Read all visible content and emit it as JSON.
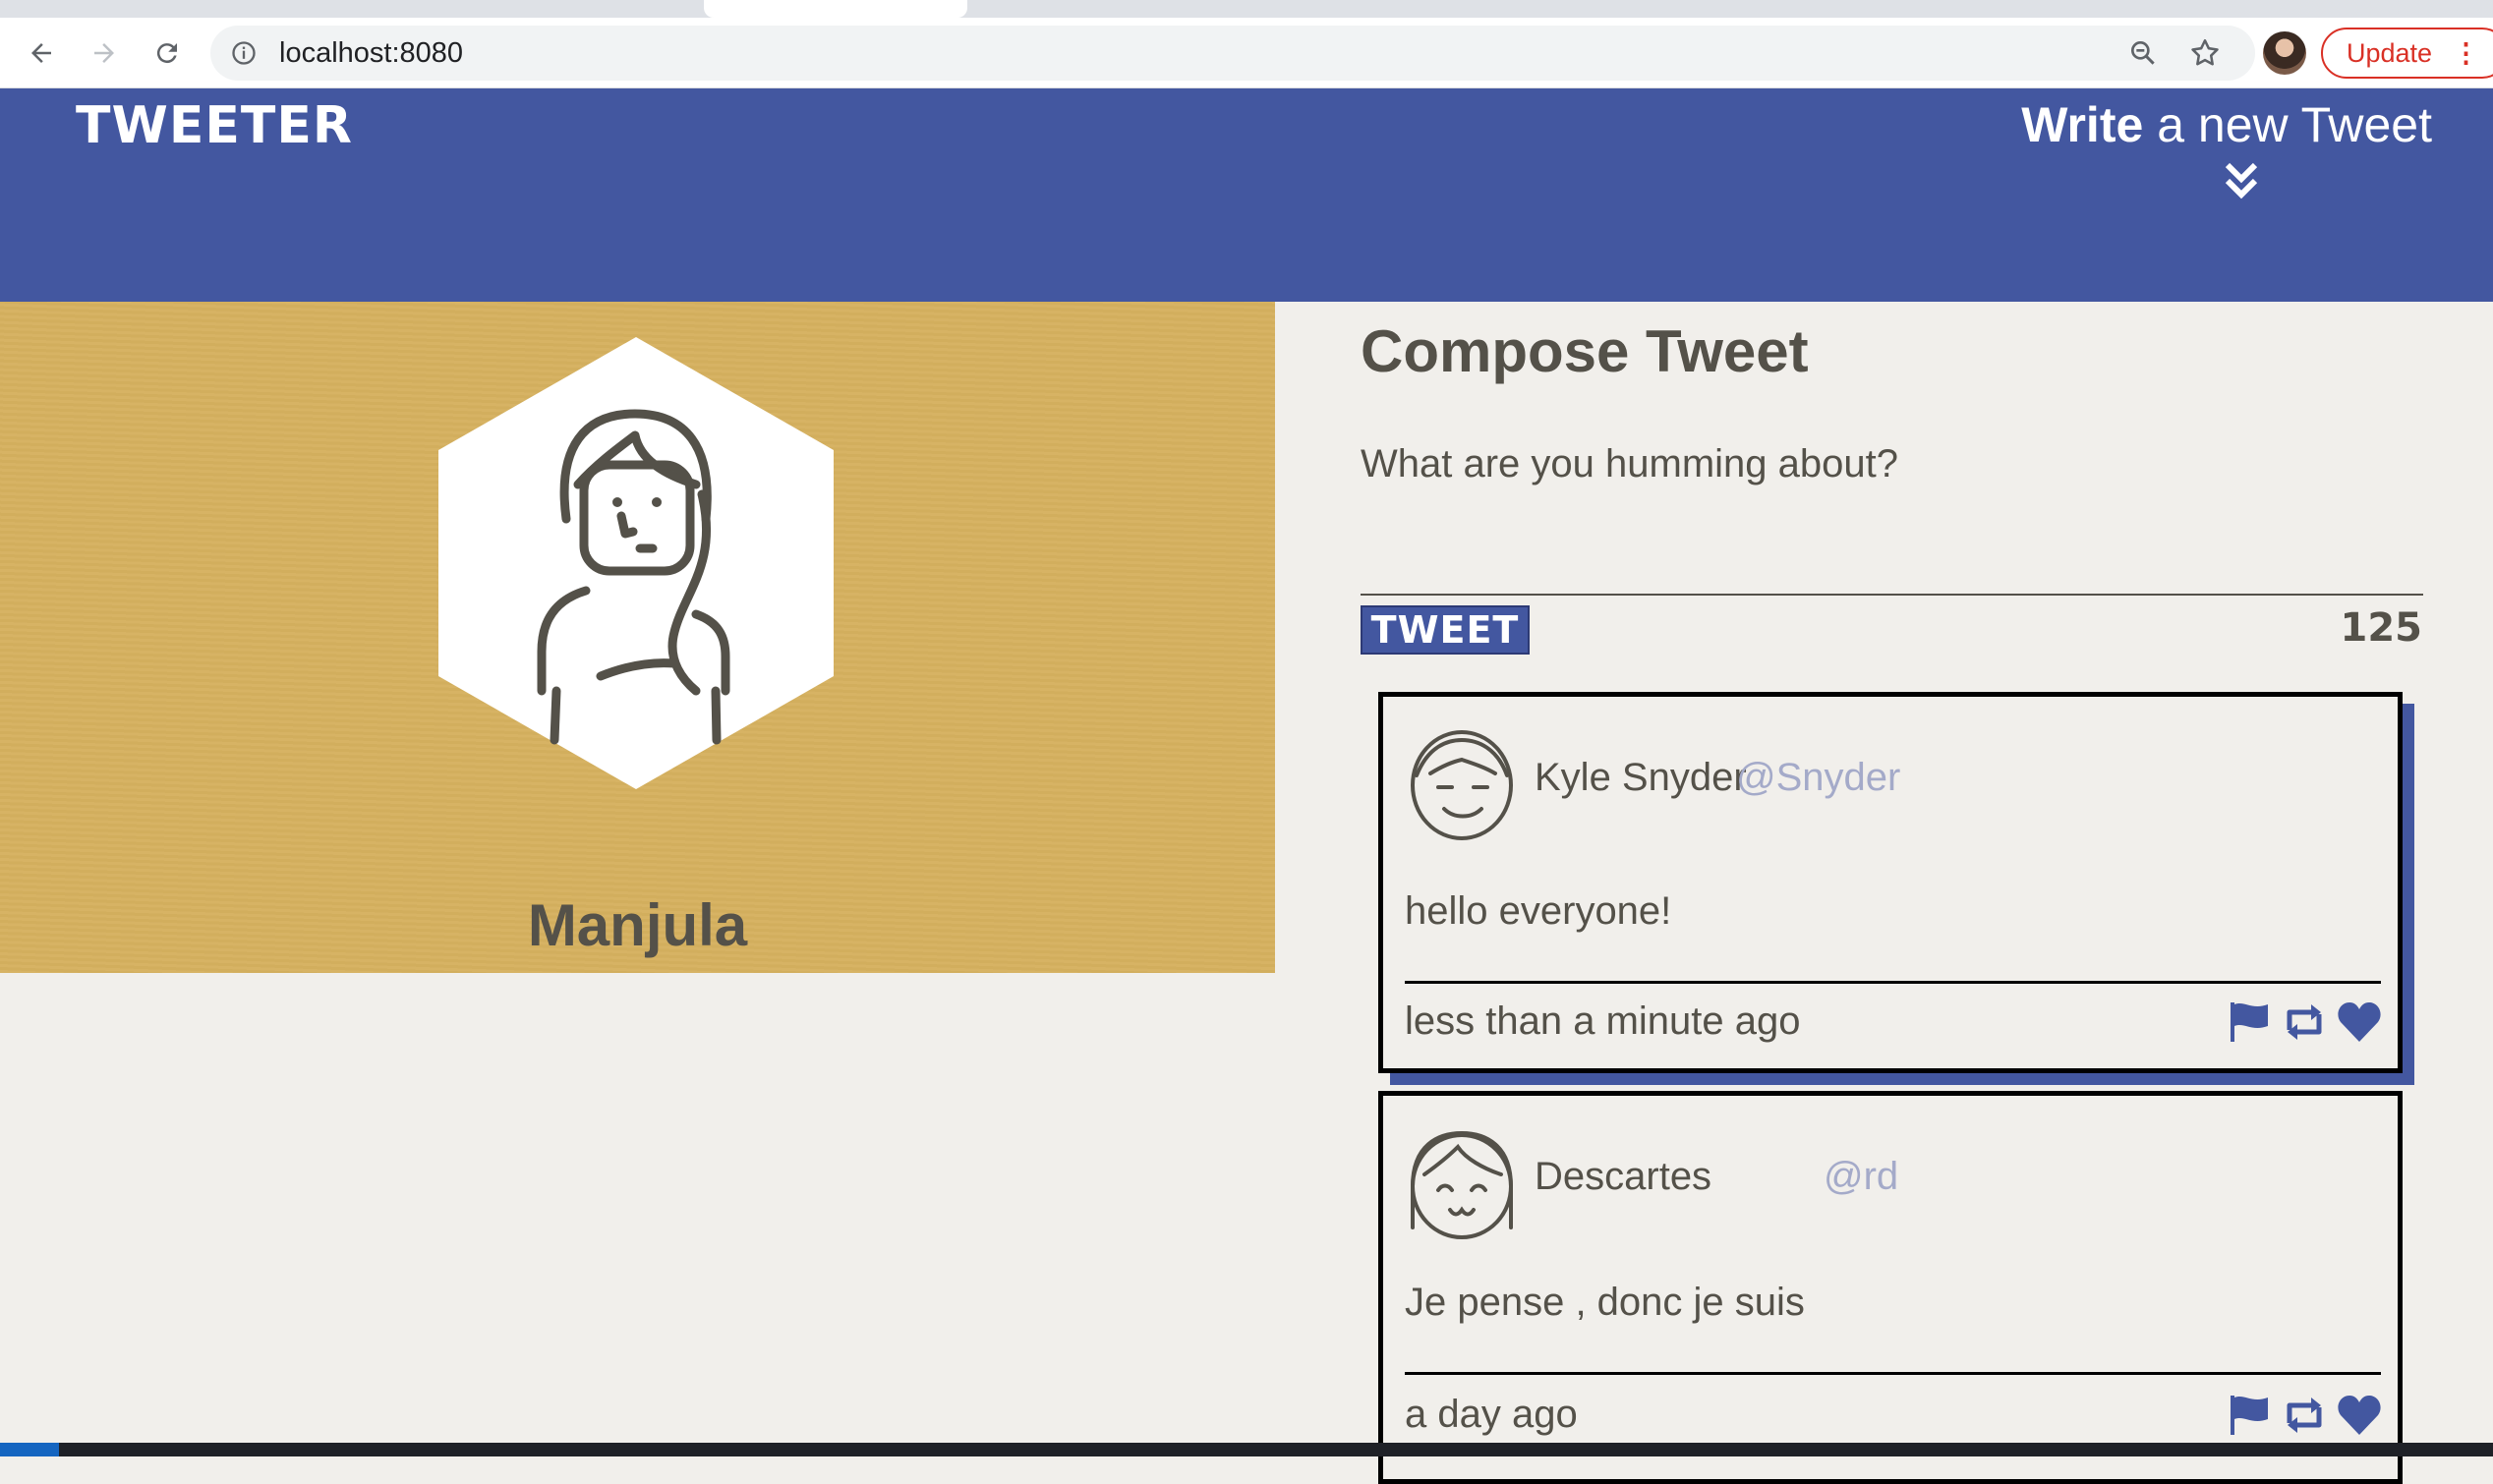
{
  "browser": {
    "url": "localhost:8080",
    "update_label": "Update",
    "menu_glyph": "⋮"
  },
  "nav": {
    "brand": "TWEETER",
    "write_bold": "Write",
    "write_rest": " a new Tweet"
  },
  "profile": {
    "name": "Manjula"
  },
  "compose": {
    "title": "Compose Tweet",
    "prompt": "What are you humming about?",
    "button": "TWEET",
    "counter": "125"
  },
  "tweets": [
    {
      "author": "Kyle Snyder",
      "handle": "@Snyder",
      "content": "hello everyone!",
      "time": "less than a minute ago"
    },
    {
      "author": "Descartes",
      "handle": "@rd",
      "content": "Je pense , donc je suis",
      "time": "a day ago"
    }
  ],
  "colors": {
    "accent": "#4357a0",
    "profile_bg": "#d6b15f",
    "page_bg": "#f1efeb",
    "text": "#545149",
    "handle": "#a4aac9"
  }
}
